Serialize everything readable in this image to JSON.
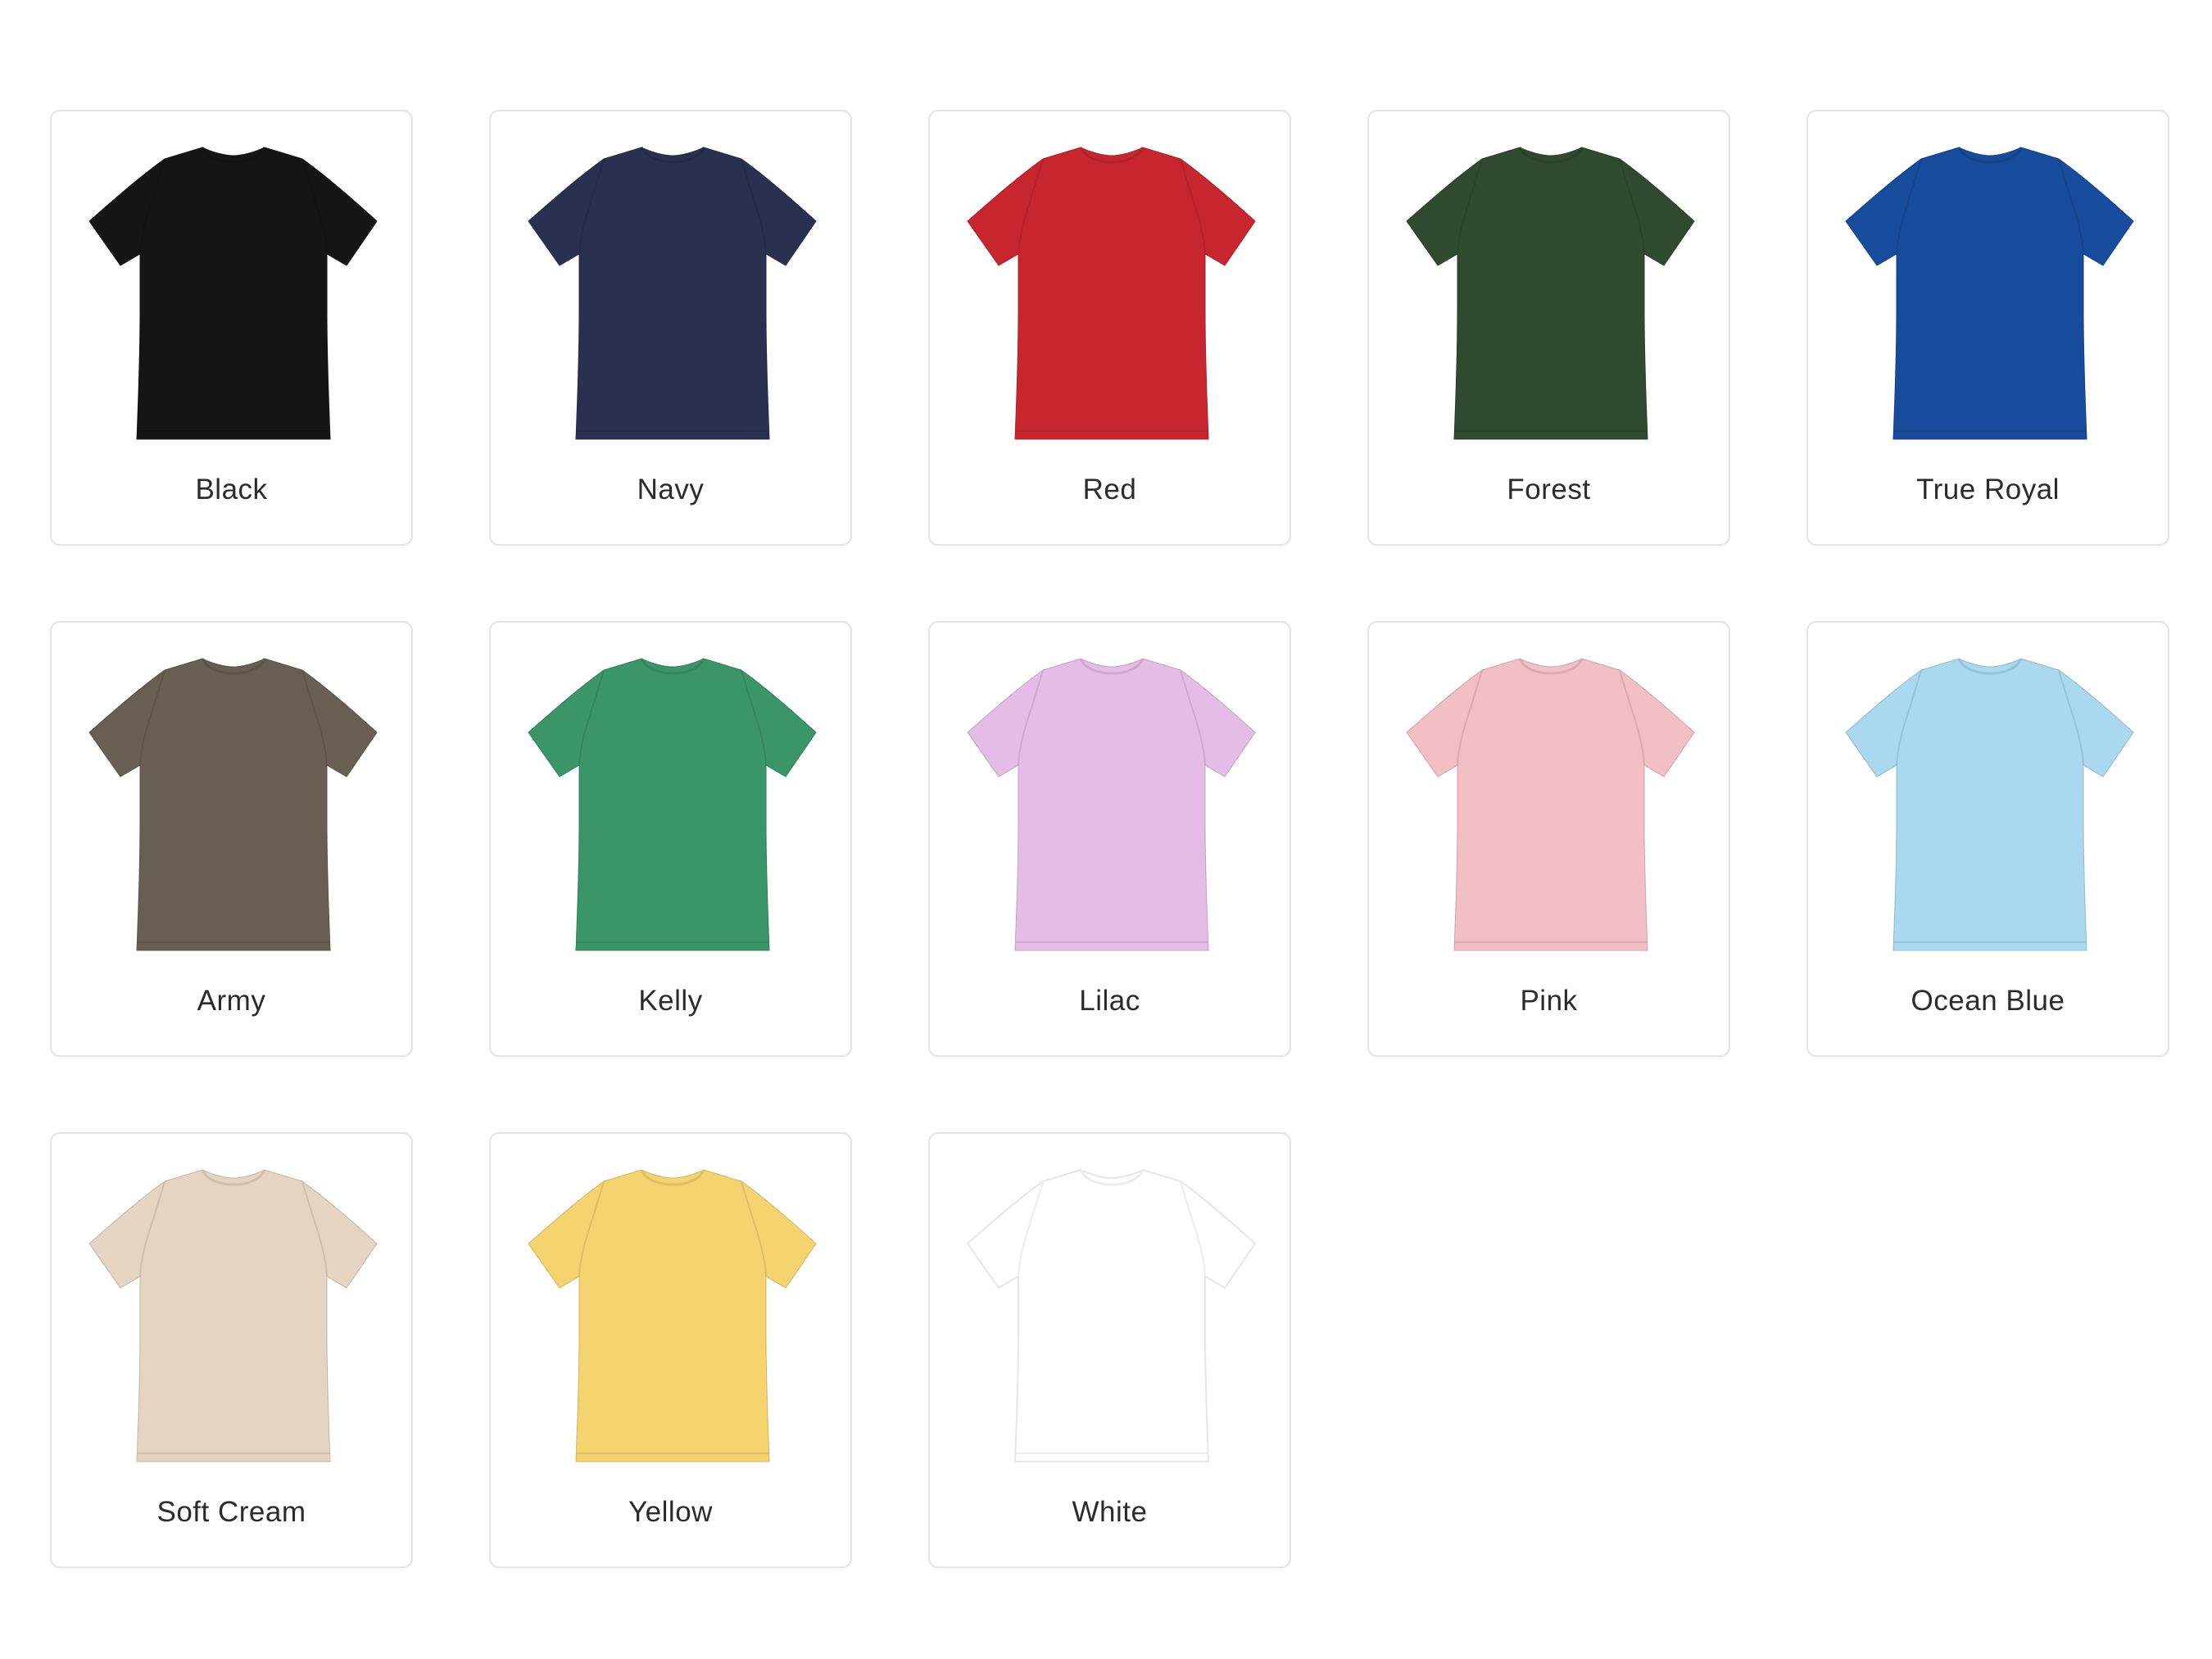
{
  "swatches": [
    {
      "label": "Black",
      "color": "#151515",
      "icon": "tshirt-icon"
    },
    {
      "label": "Navy",
      "color": "#2a3150",
      "icon": "tshirt-icon"
    },
    {
      "label": "Red",
      "color": "#c8262f",
      "icon": "tshirt-icon"
    },
    {
      "label": "Forest",
      "color": "#2f4a2e",
      "icon": "tshirt-icon"
    },
    {
      "label": "True Royal",
      "color": "#174b9c",
      "icon": "tshirt-icon"
    },
    {
      "label": "Army",
      "color": "#665f52",
      "icon": "tshirt-icon"
    },
    {
      "label": "Kelly",
      "color": "#3a9568",
      "icon": "tshirt-icon"
    },
    {
      "label": "Lilac",
      "color": "#e5bce5",
      "icon": "tshirt-icon"
    },
    {
      "label": "Pink",
      "color": "#f2bfc6",
      "icon": "tshirt-icon"
    },
    {
      "label": "Ocean Blue",
      "color": "#a9d8ef",
      "icon": "tshirt-icon"
    },
    {
      "label": "Soft Cream",
      "color": "#e5d4c2",
      "icon": "tshirt-icon"
    },
    {
      "label": "Yellow",
      "color": "#f5d46f",
      "icon": "tshirt-icon"
    },
    {
      "label": "White",
      "color": "#ffffff",
      "icon": "tshirt-icon"
    }
  ]
}
